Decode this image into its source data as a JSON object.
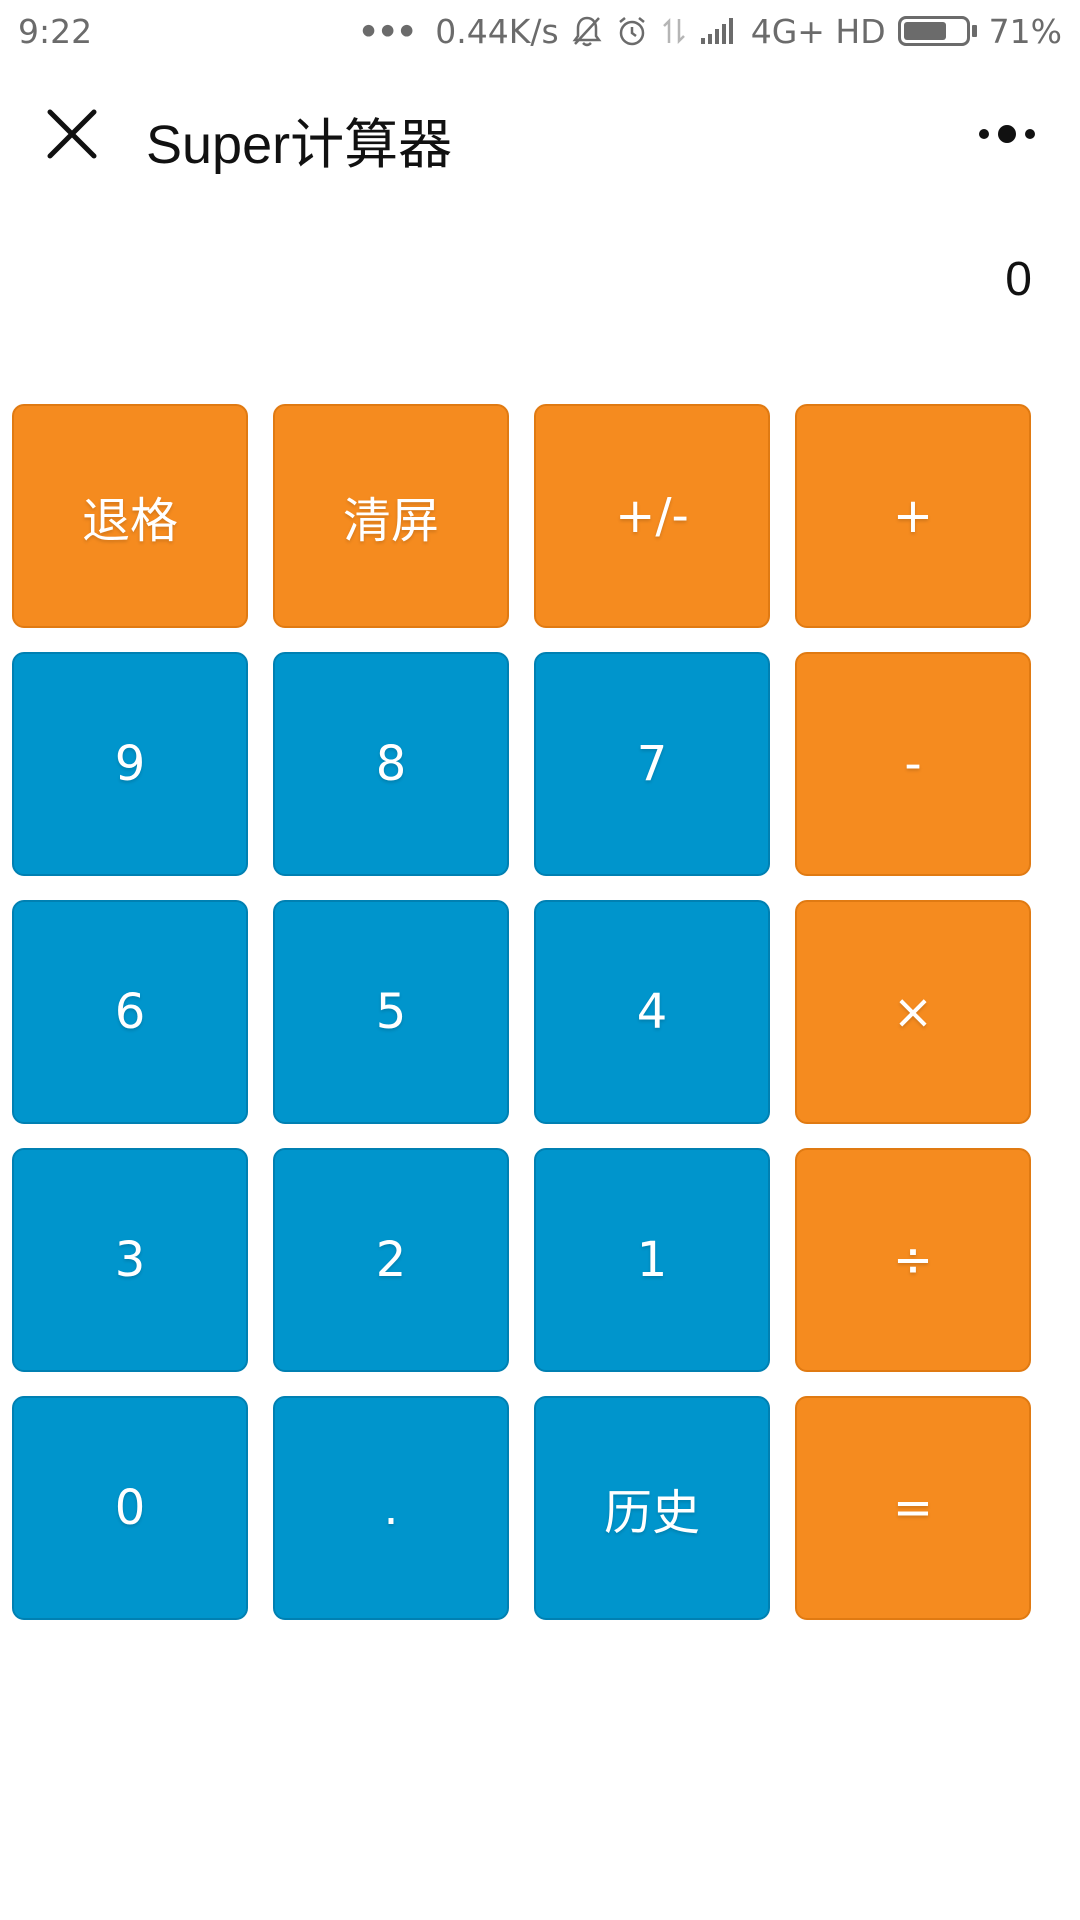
{
  "status_bar": {
    "time": "9:22",
    "dots": "•••",
    "network_speed": "0.44K/s",
    "network_type": "4G+ HD",
    "battery_percent": "71%",
    "battery_level": 0.71,
    "icons": [
      "notifications-off-icon",
      "alarm-icon",
      "data-transfer-icon",
      "signal-icon",
      "battery-icon"
    ]
  },
  "header": {
    "close_icon": "close-icon",
    "title": "Super计算器",
    "more_icon": "more-options-icon"
  },
  "display": {
    "value": "0"
  },
  "keypad": {
    "rows": [
      [
        {
          "label": "退格",
          "color": "orange"
        },
        {
          "label": "清屏",
          "color": "orange"
        },
        {
          "label": "+/-",
          "color": "orange"
        },
        {
          "label": "+",
          "color": "orange"
        }
      ],
      [
        {
          "label": "9",
          "color": "blue"
        },
        {
          "label": "8",
          "color": "blue"
        },
        {
          "label": "7",
          "color": "blue"
        },
        {
          "label": "-",
          "color": "orange"
        }
      ],
      [
        {
          "label": "6",
          "color": "blue"
        },
        {
          "label": "5",
          "color": "blue"
        },
        {
          "label": "4",
          "color": "blue"
        },
        {
          "label": "×",
          "color": "orange"
        }
      ],
      [
        {
          "label": "3",
          "color": "blue"
        },
        {
          "label": "2",
          "color": "blue"
        },
        {
          "label": "1",
          "color": "blue"
        },
        {
          "label": "÷",
          "color": "orange"
        }
      ],
      [
        {
          "label": "0",
          "color": "blue"
        },
        {
          "label": ".",
          "color": "blue"
        },
        {
          "label": "历史",
          "color": "blue"
        },
        {
          "label": "=",
          "color": "orange"
        }
      ]
    ]
  },
  "colors": {
    "orange": "#f58b1f",
    "blue": "#0095cc",
    "text_dark": "#111111",
    "status_gray": "#6b6b6b"
  }
}
